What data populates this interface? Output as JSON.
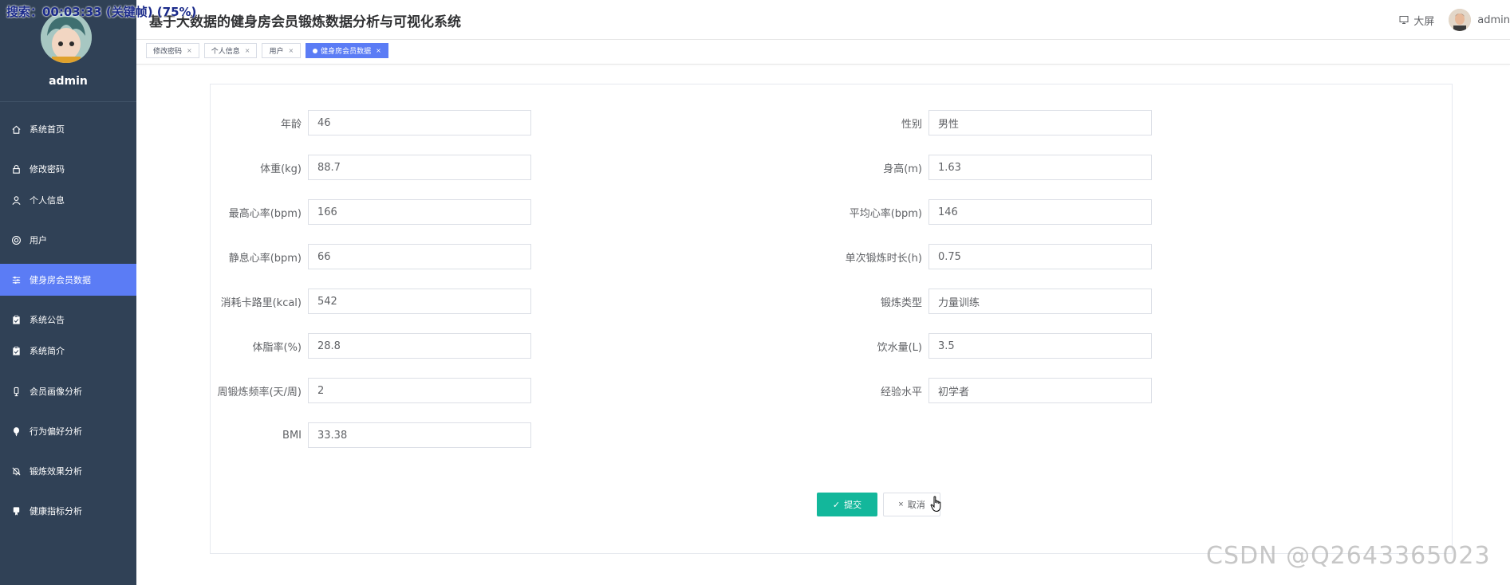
{
  "overlay": {
    "search_text": "搜索：00:03:33 (关键帧) (75%)"
  },
  "header": {
    "title": "基于大数据的健身房会员锻炼数据分析与可视化系统",
    "bigscreen_label": "大屏",
    "user": "admin"
  },
  "sidebar": {
    "username": "admin",
    "items": [
      {
        "label": "系统首页",
        "icon": "home-icon"
      },
      {
        "label": "修改密码",
        "icon": "lock-icon"
      },
      {
        "label": "个人信息",
        "icon": "user-icon"
      },
      {
        "label": "用户",
        "icon": "lifebuoy-icon"
      },
      {
        "label": "健身房会员数据",
        "icon": "sliders-icon",
        "active": true
      },
      {
        "label": "系统公告",
        "icon": "clipboard-icon"
      },
      {
        "label": "系统简介",
        "icon": "clipboard-icon"
      },
      {
        "label": "会员画像分析",
        "icon": "tag-icon"
      },
      {
        "label": "行为偏好分析",
        "icon": "balloon-icon"
      },
      {
        "label": "锻炼效果分析",
        "icon": "bell-off-icon"
      },
      {
        "label": "健康指标分析",
        "icon": "badge-icon"
      }
    ]
  },
  "tabs": [
    {
      "label": "修改密码"
    },
    {
      "label": "个人信息"
    },
    {
      "label": "用户"
    },
    {
      "label": "健身房会员数据",
      "active": true
    }
  ],
  "form": {
    "left": [
      {
        "label": "年龄",
        "value": "46"
      },
      {
        "label": "体重(kg)",
        "value": "88.7"
      },
      {
        "label": "最高心率(bpm)",
        "value": "166"
      },
      {
        "label": "静息心率(bpm)",
        "value": "66"
      },
      {
        "label": "消耗卡路里(kcal)",
        "value": "542"
      },
      {
        "label": "体脂率(%)",
        "value": "28.8"
      },
      {
        "label": "周锻炼频率(天/周)",
        "value": "2"
      },
      {
        "label": "BMI",
        "value": "33.38"
      }
    ],
    "right": [
      {
        "label": "性别",
        "value": "男性"
      },
      {
        "label": "身高(m)",
        "value": "1.63"
      },
      {
        "label": "平均心率(bpm)",
        "value": "146"
      },
      {
        "label": "单次锻炼时长(h)",
        "value": "0.75"
      },
      {
        "label": "锻炼类型",
        "value": "力量训练"
      },
      {
        "label": "饮水量(L)",
        "value": "3.5"
      },
      {
        "label": "经验水平",
        "value": "初学者"
      }
    ],
    "submit_label": "提交",
    "cancel_label": "取消"
  },
  "watermark": "CSDN @Q2643365023",
  "colors": {
    "sidebar_bg": "#304156",
    "accent": "#5b7cf5",
    "submit": "#13b79b"
  }
}
